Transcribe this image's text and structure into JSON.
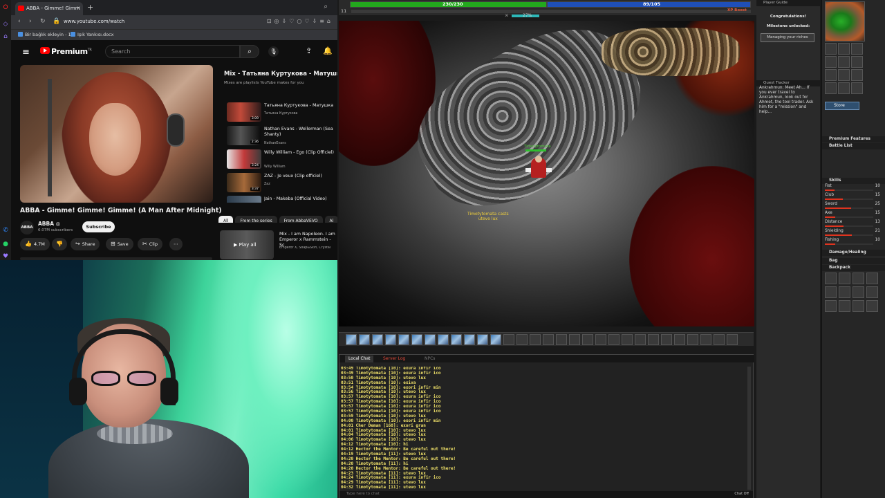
{
  "browser": {
    "tab_title": "ABBA - Gimme! Gimm",
    "url": "www.youtube.com/watch",
    "bookmarks": [
      "Bir bağlık ekleyin - 1...",
      "Işık Yankısı.docx"
    ]
  },
  "youtube": {
    "brand": "Premium",
    "brand_sup": "TR",
    "search_placeholder": "Search",
    "video_title": "ABBA - Gimme! Gimme! Gimme! (A Man After Midnight)",
    "channel_avatar": "ABBA",
    "channel_name": "ABBA ◎",
    "channel_subs": "6.07M subscribers",
    "subscribe_label": "Subscribe",
    "actions": {
      "likes": "4.7M",
      "share": "Share",
      "save": "Save",
      "clip": "Clip",
      "more": "⋯"
    },
    "playlist": {
      "title": "Mix - Татьяна Куртукова - Матушка",
      "subtitle": "Mixes are playlists YouTube makes for you",
      "items": [
        {
          "name": "Татьяна Куртукова - Матушка",
          "artist": "Татьяна Куртукова",
          "duration": "3:09"
        },
        {
          "name": "Nathan Evans - Wellerman (Sea Shanty)",
          "artist": "NathanEvans",
          "duration": "2:36"
        },
        {
          "name": "Willy William - Ego (Clip Officiel)",
          "artist": "Willy William",
          "duration": "3:24"
        },
        {
          "name": "ZAZ - Je veux (Clip officiel)",
          "artist": "Zaz",
          "duration": "3:37"
        },
        {
          "name": "Jain - Makeba (Official Video)",
          "artist": "",
          "duration": ""
        }
      ]
    },
    "chips": [
      "All",
      "From the series",
      "From AbbaVEVO",
      "Al"
    ],
    "recommended": {
      "play_all": "Play all",
      "title": "Mix - I am Napoleon. I am Emperor x Rammstein - Sc",
      "meta": "Emperor X, Soap&Skin, Crystal"
    }
  },
  "game": {
    "hp": "230/230",
    "mana": "89/105",
    "level": "11",
    "xp_boost": "XP Boost",
    "stamina_pct": "27%",
    "player_name": "Timotytomata",
    "spell_text": [
      "Timotytomata casts",
      "utevo lux"
    ],
    "chat": {
      "tabs": [
        "Local Chat",
        "Server Log",
        "NPCs"
      ],
      "lines": [
        "03:49 Timotytomata [10]: exura infir ico",
        "03:49 Timotytomata [10]: exura infir ico",
        "03:50 Timotytomata [10]: utevo lux",
        "03:51 Timotytomata [10]: exiva",
        "03:54 Timotytomata [10]: exori infir min",
        "03:56 Timotytomata [10]: utevo lux",
        "03:57 Timotytomata [10]: exura infir ico",
        "03:57 Timotytomata [10]: exura infir ico",
        "03:57 Timotytomata [10]: exura infir ico",
        "03:57 Timotytomata [10]: exura infir ico",
        "03:59 Timotytomata [10]: utevo lux",
        "04:00 Timotytomata [10]: exori infir min",
        "04:01 Cher Deman [168]: exori gran",
        "04:01 Timotytomata [10]: utevo lux",
        "04:04 Timotytomata [10]: utevo lux",
        "04:06 Timotytomata [10]: utevo lux",
        "04:12 Timotytomata [10]: hi",
        "04:12 Hector the Mentor: Be careful out there!",
        "04:19 Timotytomata [11]: utevo lux",
        "04:20 Hector the Mentor: Be careful out there!",
        "04:20 Timotytomata [11]: hi",
        "04:20 Hector the Mentor: Be careful out there!",
        "04:23 Timotytomata [11]: utevo lux",
        "04:24 Timotytomata [11]: exura infir ico",
        "04:29 Timotytomata [11]: utevo lux",
        "04:32 Timotytomata [11]: utevo lux"
      ],
      "input_placeholder": "Type here to chat",
      "chat_off": "Chat Off"
    },
    "player_guide": {
      "title": "Player Guide",
      "line1": "Congratulations!",
      "line2": "Milestone unlocked:",
      "button": "Managing your riches"
    },
    "quest_tracker": {
      "title": "Quest Tracker",
      "text": "Ankrahmun: Meet Ah... If you ever travel to Ankrahmun, look out for Ahmet, the tool trader. Ask him for a \"mission\" and help..."
    },
    "store": "Store",
    "premium_features": "Premium Features",
    "battle_list": "Battle List",
    "skills_title": "Skills",
    "skills": [
      {
        "name": "Fist",
        "value": "10"
      },
      {
        "name": "Club",
        "value": "15"
      },
      {
        "name": "Sword",
        "value": "25"
      },
      {
        "name": "Axe",
        "value": "15"
      },
      {
        "name": "Distance",
        "value": "13"
      },
      {
        "name": "Shielding",
        "value": "21"
      },
      {
        "name": "Fishing",
        "value": "10"
      }
    ],
    "damage_healing": "Damage/Healing",
    "bag_title": "Bag",
    "backpack_title": "Backpack"
  }
}
